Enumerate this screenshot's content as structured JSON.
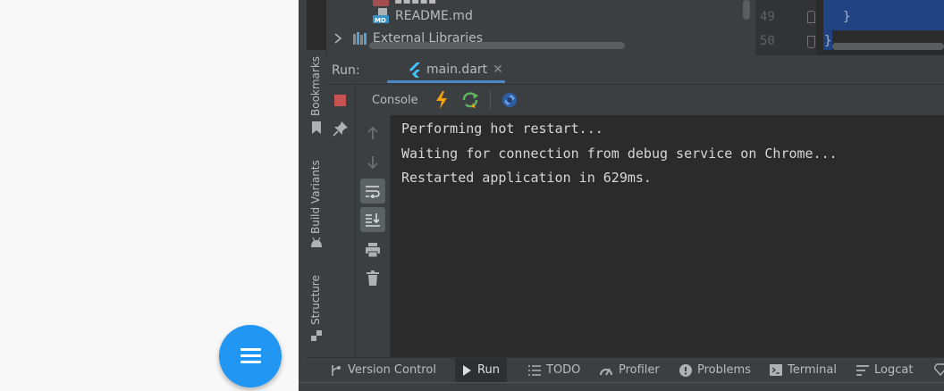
{
  "project_tree": {
    "readme": "README.md",
    "external_libraries": "External Libraries"
  },
  "editor": {
    "line_49": "49",
    "line_50": "50",
    "code_49": "}",
    "code_50": "}"
  },
  "side_tabs": {
    "bookmarks": "Bookmarks",
    "build_variants": "Build Variants",
    "structure": "Structure"
  },
  "run_panel": {
    "label": "Run:",
    "tab": "main.dart",
    "console_tab": "Console"
  },
  "console": {
    "lines": [
      "Performing hot restart...",
      "Waiting for connection from debug service on Chrome...",
      "Restarted application in 629ms."
    ]
  },
  "bottom_tools": [
    {
      "label": "Version Control",
      "icon": "branch-icon"
    },
    {
      "label": "Run",
      "icon": "play-icon"
    },
    {
      "label": "TODO",
      "icon": "list-icon"
    },
    {
      "label": "Profiler",
      "icon": "gauge-icon"
    },
    {
      "label": "Problems",
      "icon": "warning-icon"
    },
    {
      "label": "Terminal",
      "icon": "terminal-icon"
    },
    {
      "label": "Logcat",
      "icon": "logcat-icon"
    }
  ],
  "colors": {
    "fab": "#2196f3",
    "ide_bg": "#2b2b2b",
    "panel_bg": "#3c3f41",
    "selection": "#214283",
    "stop": "#c75450",
    "flutter_blue": "#40c4ff"
  }
}
